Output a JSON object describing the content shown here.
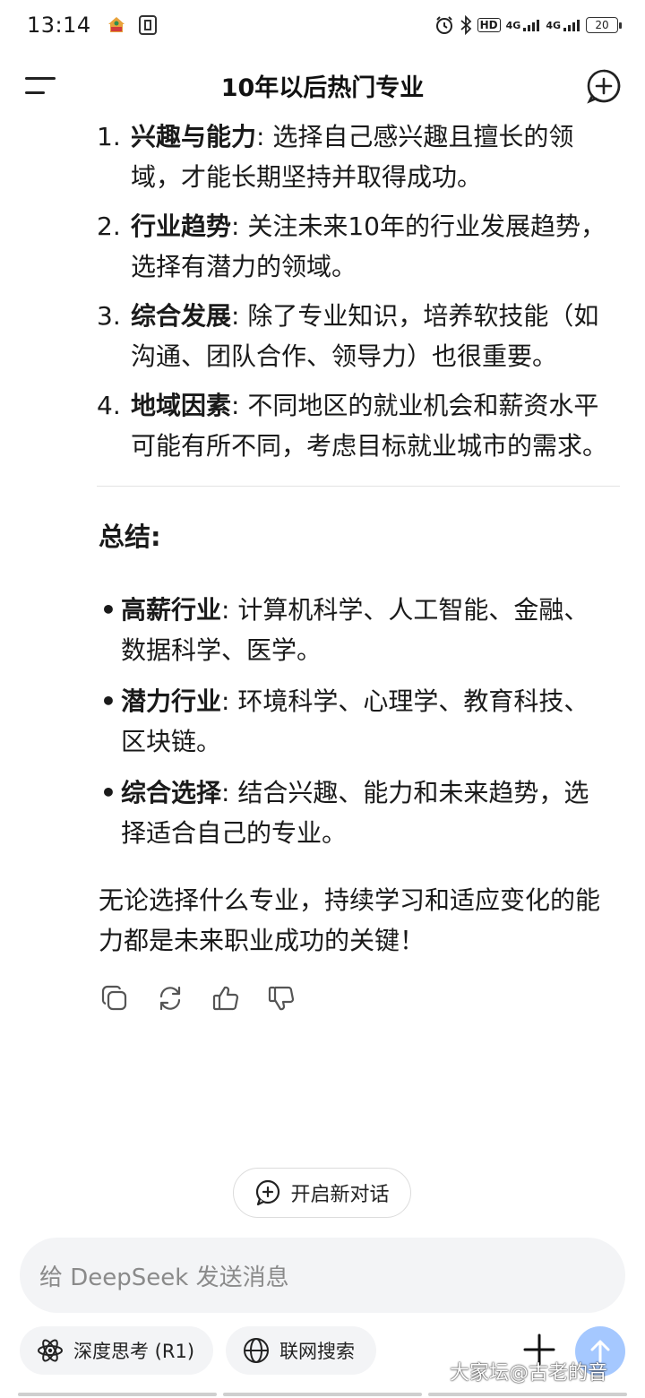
{
  "status_bar": {
    "time": "13:14",
    "signal_1": "4G",
    "signal_2": "4G",
    "hd_label": "HD",
    "battery": "20"
  },
  "header": {
    "title": "10年以后热门专业"
  },
  "factors": [
    {
      "num": "1.",
      "label": "兴趣与能力",
      "text": ": 选择自己感兴趣且擅长的领域，才能长期坚持并取得成功。"
    },
    {
      "num": "2.",
      "label": "行业趋势",
      "text": ": 关注未来10年的行业发展趋势，选择有潜力的领域。"
    },
    {
      "num": "3.",
      "label": "综合发展",
      "text": ": 除了专业知识，培养软技能（如沟通、团队合作、领导力）也很重要。"
    },
    {
      "num": "4.",
      "label": "地域因素",
      "text": ": 不同地区的就业机会和薪资水平可能有所不同，考虑目标就业城市的需求。"
    }
  ],
  "summary": {
    "title": "总结:",
    "items": [
      {
        "label": "高薪行业",
        "text": ": 计算机科学、人工智能、金融、数据科学、医学。"
      },
      {
        "label": "潜力行业",
        "text": ": 环境科学、心理学、教育科技、区块链。"
      },
      {
        "label": "综合选择",
        "text": ": 结合兴趣、能力和未来趋势，选择适合自己的专业。"
      }
    ],
    "closing": "无论选择什么专业，持续学习和适应变化的能力都是未来职业成功的关键！"
  },
  "new_chat_label": "开启新对话",
  "input": {
    "placeholder": "给 DeepSeek 发送消息"
  },
  "chips": {
    "deep_think": "深度思考 (R1)",
    "web_search": "联网搜索"
  },
  "watermark": "大家坛@古老的音",
  "colors": {
    "send_button": "#a5c8ff",
    "input_bg": "#f3f4f6"
  }
}
